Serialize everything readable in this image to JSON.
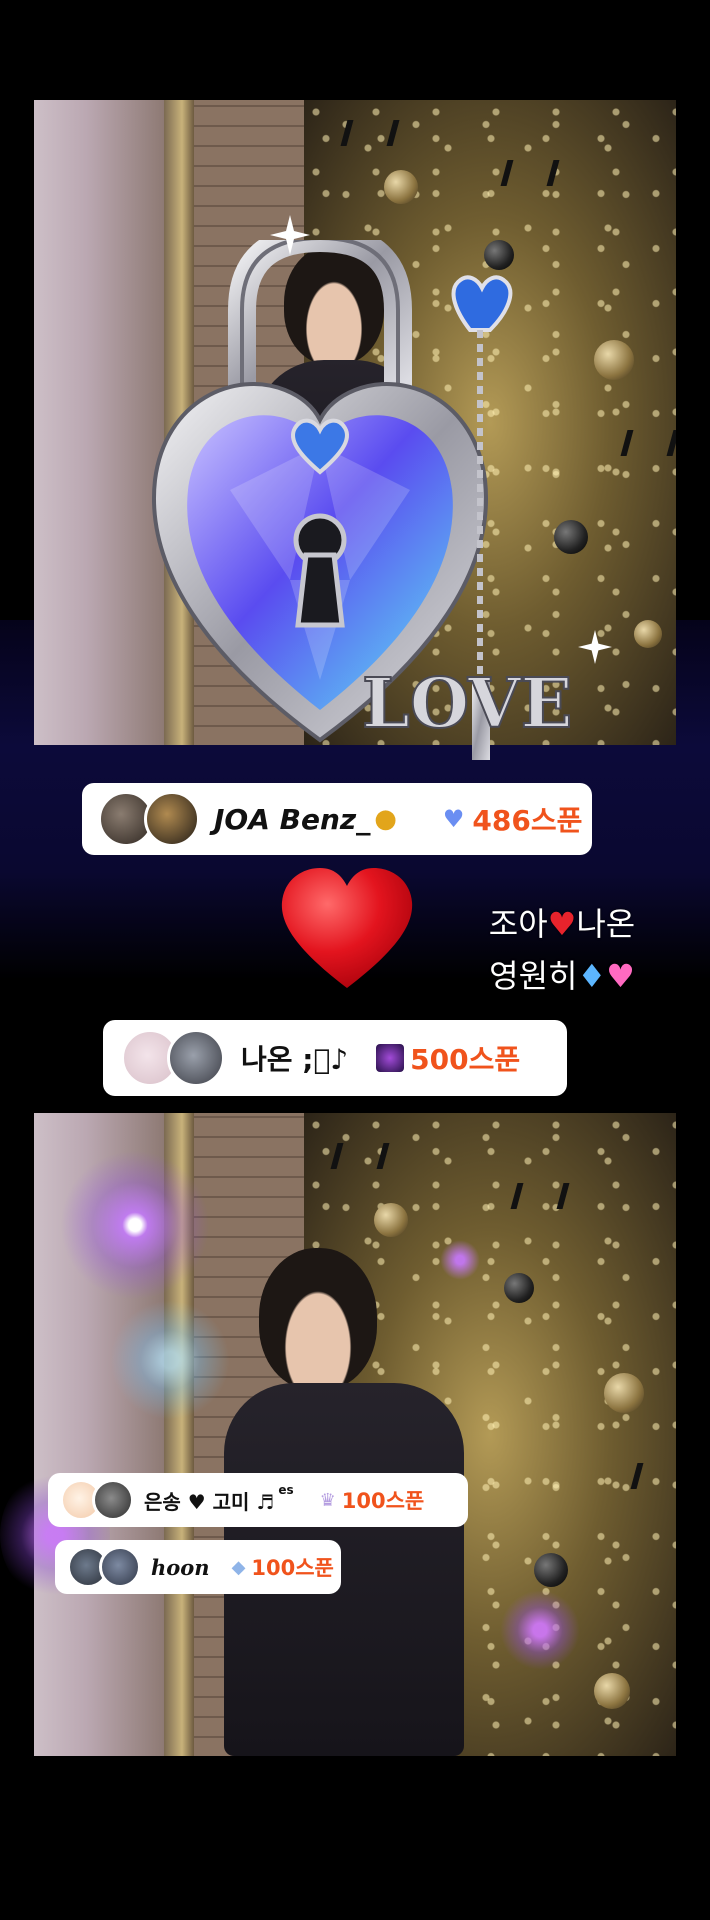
{
  "badges": [
    {
      "name": "JOA Benz_",
      "medal_icon": "gold-medal-icon",
      "gift_icon": "lock-heart-icon",
      "amount": "486스푼"
    },
    {
      "name": "나온 ;゚♪",
      "gift_icon": "galaxy-icon",
      "amount": "500스푼"
    },
    {
      "name": "은송 ♥ 고미 ♬",
      "suffix": "es",
      "gift_icon": "crown-icon",
      "amount": "100스푼"
    },
    {
      "name": "hoon",
      "gift_icon": "crystal-icon",
      "amount": "100스푼"
    }
  ],
  "caption": {
    "line1_a": "조아",
    "line1_b": "나온",
    "line2": "영원히"
  },
  "sticker_text": "LOVE",
  "colors": {
    "amount": "#f0531c",
    "heart": "#e8232c",
    "background": "#000000"
  }
}
